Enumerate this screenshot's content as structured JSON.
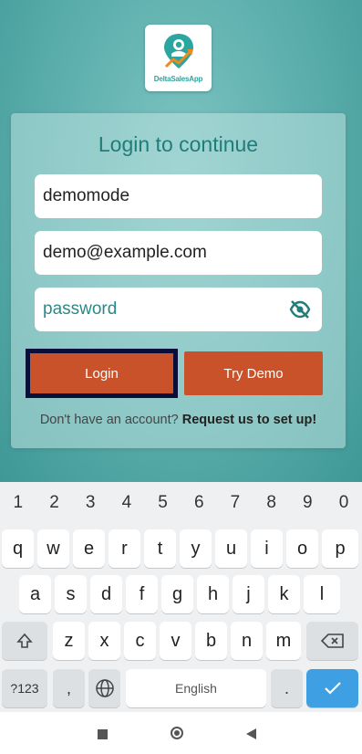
{
  "logo": {
    "text": "DeltaSalesApp"
  },
  "card": {
    "title": "Login to continue",
    "username_value": "demomode",
    "email_value": "demo@example.com",
    "password_placeholder": "password",
    "login_label": "Login",
    "try_demo_label": "Try Demo",
    "signup_prompt": "Don't have an account?",
    "signup_link": "Request us to set up!"
  },
  "colors": {
    "accent": "#c9522a",
    "teal": "#2a8a88",
    "enter": "#3ea0e2"
  },
  "keyboard": {
    "numbers": [
      "1",
      "2",
      "3",
      "4",
      "5",
      "6",
      "7",
      "8",
      "9",
      "0"
    ],
    "row1": [
      "q",
      "w",
      "e",
      "r",
      "t",
      "y",
      "u",
      "i",
      "o",
      "p"
    ],
    "row2": [
      "a",
      "s",
      "d",
      "f",
      "g",
      "h",
      "j",
      "k",
      "l"
    ],
    "row3": [
      "z",
      "x",
      "c",
      "v",
      "b",
      "n",
      "m"
    ],
    "sym_label": "?123",
    "comma": ",",
    "period": ".",
    "space_label": "English"
  }
}
